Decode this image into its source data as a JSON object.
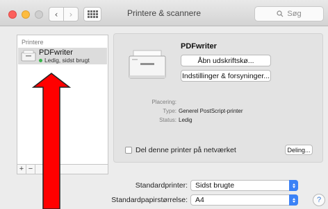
{
  "window": {
    "title": "Printere & scannere",
    "search_placeholder": "Søg"
  },
  "toolbar": {
    "back_icon": "‹",
    "forward_icon": "›",
    "grid_icon": "show-all-grid"
  },
  "sidebar": {
    "header": "Printere",
    "items": [
      {
        "name": "PDFwriter",
        "status": "Ledig, sidst brugt",
        "status_color": "#39b54a"
      }
    ],
    "add_label": "+",
    "remove_label": "−"
  },
  "detail": {
    "printer_name": "PDFwriter",
    "open_queue_label": "Åbn udskriftskø...",
    "options_label": "Indstillinger & forsyninger...",
    "location_label": "Placering:",
    "location_value": "",
    "type_label": "Type:",
    "type_value": "Generel PostScript-printer",
    "status_label": "Status:",
    "status_value": "Ledig",
    "share_label": "Del denne printer på netværket",
    "share_checked": false,
    "sharing_button_label": "Deling..."
  },
  "defaults": {
    "printer_label": "Standardprinter:",
    "printer_value": "Sidst brugte",
    "paper_label": "Standardpapirstørrelse:",
    "paper_value": "A4"
  },
  "help_label": "?",
  "colors": {
    "accent": "#3b82f6",
    "annotation_arrow": "#ff0000"
  }
}
